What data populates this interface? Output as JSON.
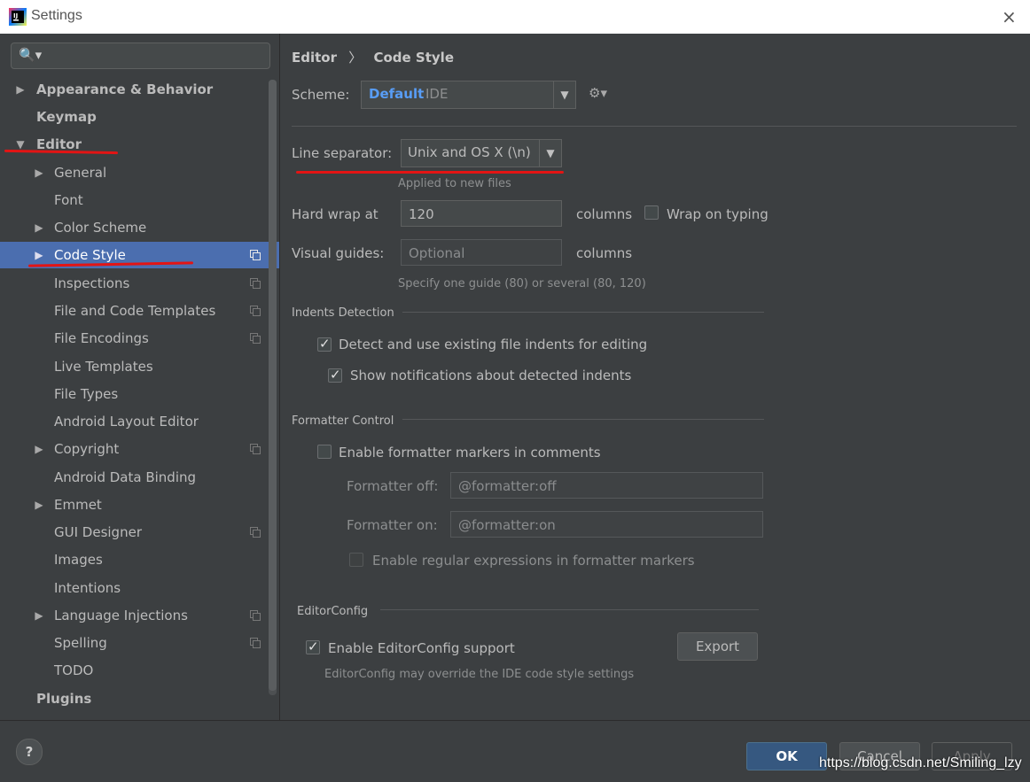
{
  "window": {
    "title": "Settings",
    "close_icon": "×"
  },
  "search": {
    "icon": "🔍▾",
    "value": ""
  },
  "tree": {
    "items": [
      {
        "label": "Appearance & Behavior",
        "arrow": "▶"
      },
      {
        "label": "Keymap"
      },
      {
        "label": "Editor",
        "arrow": "▼"
      },
      {
        "label": "General",
        "arrow": "▶"
      },
      {
        "label": "Font"
      },
      {
        "label": "Color Scheme",
        "arrow": "▶"
      },
      {
        "label": "Code Style",
        "arrow": "▶"
      },
      {
        "label": "Inspections"
      },
      {
        "label": "File and Code Templates"
      },
      {
        "label": "File Encodings"
      },
      {
        "label": "Live Templates"
      },
      {
        "label": "File Types"
      },
      {
        "label": "Android Layout Editor"
      },
      {
        "label": "Copyright",
        "arrow": "▶"
      },
      {
        "label": "Android Data Binding"
      },
      {
        "label": "Emmet",
        "arrow": "▶"
      },
      {
        "label": "GUI Designer"
      },
      {
        "label": "Images"
      },
      {
        "label": "Intentions"
      },
      {
        "label": "Language Injections",
        "arrow": "▶"
      },
      {
        "label": "Spelling"
      },
      {
        "label": "TODO"
      },
      {
        "label": "Plugins"
      }
    ]
  },
  "breadcrumb": {
    "part1": "Editor",
    "sep": "〉",
    "part2": "Code Style"
  },
  "scheme": {
    "label": "Scheme:",
    "name": "Default",
    "tag": "IDE",
    "arrow": "▼",
    "gear": "⚙▾"
  },
  "line_sep": {
    "label": "Line separator:",
    "value": "Unix and OS X (\\n)",
    "arrow": "▼",
    "hint": "Applied to new files"
  },
  "hard_wrap": {
    "label": "Hard wrap at",
    "value": "120",
    "unit": "columns",
    "wrap_label": "Wrap on typing"
  },
  "visual_guides": {
    "label": "Visual guides:",
    "placeholder": "Optional",
    "unit": "columns",
    "hint": "Specify one guide (80) or several (80, 120)"
  },
  "indents": {
    "title": "Indents Detection",
    "detect": "Detect and use existing file indents for editing",
    "notify": "Show notifications about detected indents"
  },
  "formatter": {
    "title": "Formatter Control",
    "enable": "Enable formatter markers in comments",
    "off_label": "Formatter off:",
    "off_value": "@formatter:off",
    "on_label": "Formatter on:",
    "on_value": "@formatter:on",
    "regex": "Enable regular expressions in formatter markers"
  },
  "editorconfig": {
    "title": "EditorConfig",
    "enable": "Enable EditorConfig support",
    "export": "Export",
    "hint": "EditorConfig may override the IDE code style settings"
  },
  "footer": {
    "help": "?",
    "ok": "OK",
    "cancel": "Cancel",
    "apply": "Apply"
  },
  "watermark": "https://blog.csdn.net/Smiling_lzy",
  "colors": {
    "selection": "#4b6eaf",
    "accent": "#589df6",
    "annotation": "#e31414"
  }
}
